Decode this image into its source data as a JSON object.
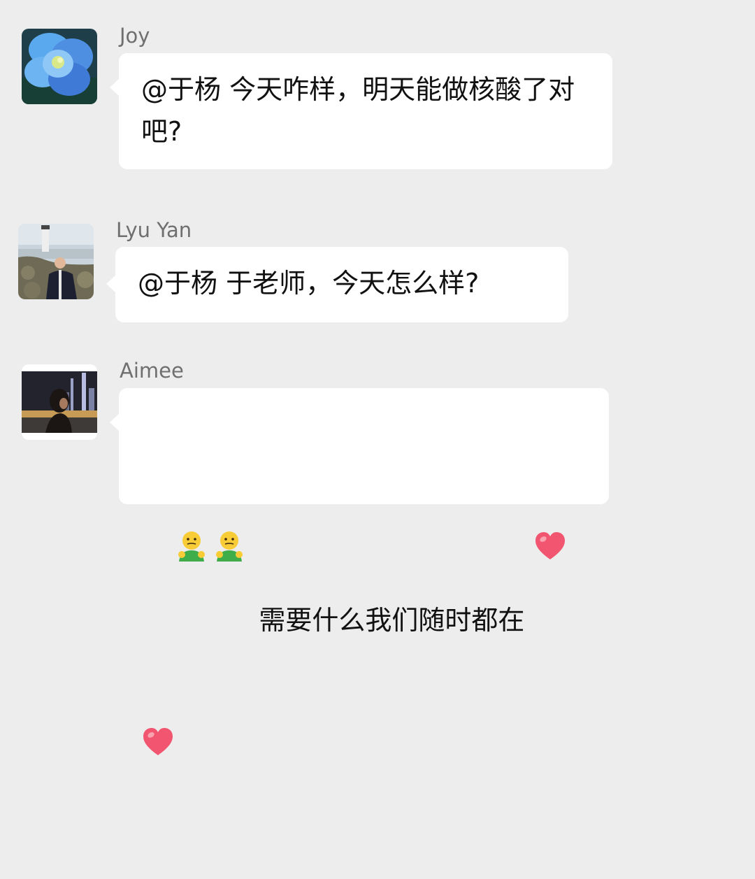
{
  "messages": [
    {
      "sender": "Joy",
      "avatar_icon": "blue-flower-avatar",
      "text": "@于杨 今天咋样，明天能做核酸了对吧?"
    },
    {
      "sender": "Lyu Yan",
      "avatar_icon": "lighthouse-photo-avatar",
      "text": "@于杨 于老师，今天怎么样?"
    },
    {
      "sender": "Aimee",
      "avatar_icon": "night-city-photo-avatar",
      "emojis_before": [
        "hug-emoji",
        "hug-emoji"
      ],
      "text": " 需要什么我们随时都在 ",
      "emojis_after": [
        "heart-emoji",
        "heart-emoji"
      ]
    }
  ],
  "colors": {
    "background": "#ededed",
    "bubble": "#ffffff",
    "sender_name": "#6f6f6f",
    "message_text": "#111111",
    "heart": "#f2556f"
  }
}
